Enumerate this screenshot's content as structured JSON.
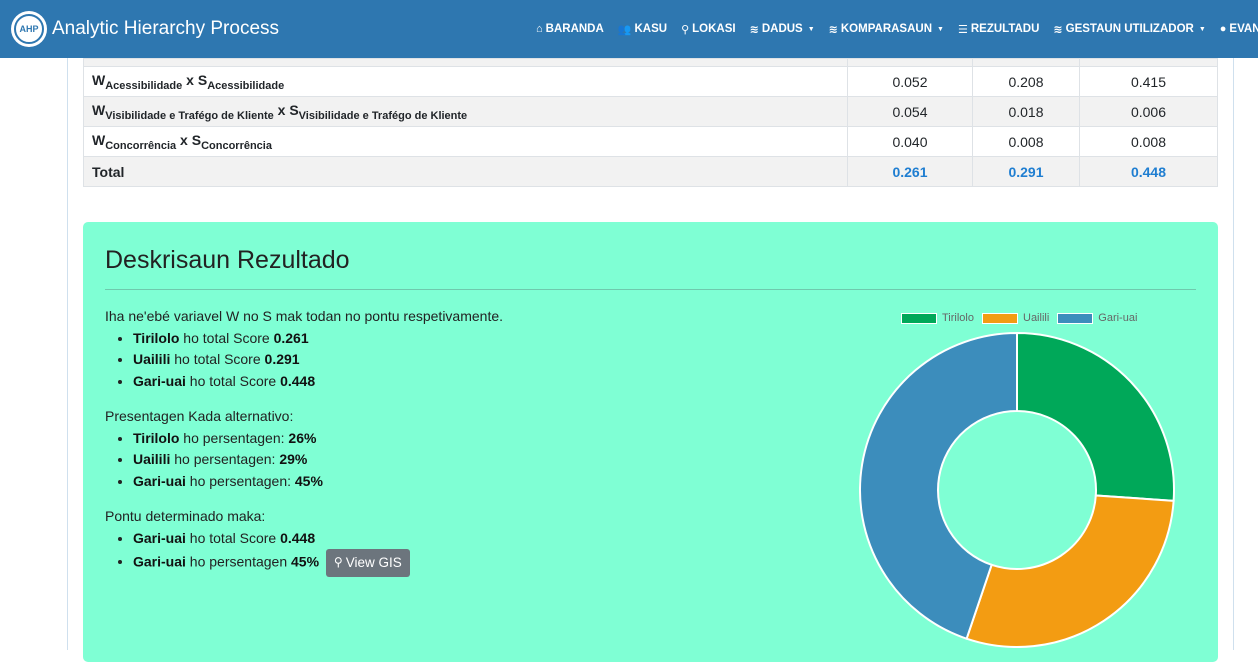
{
  "navbar": {
    "logo_text": "AHP",
    "title": "Analytic Hierarchy Process",
    "items": [
      {
        "icon": "home-icon",
        "glyph": "⌂",
        "label": "BARANDA",
        "dropdown": false
      },
      {
        "icon": "users-icon",
        "glyph": "👥",
        "label": "KASU",
        "dropdown": false
      },
      {
        "icon": "map-marker-icon",
        "glyph": "⚲",
        "label": "LOKASI",
        "dropdown": false
      },
      {
        "icon": "database-icon",
        "glyph": "≋",
        "label": "DADUS",
        "dropdown": true
      },
      {
        "icon": "database-icon",
        "glyph": "≋",
        "label": "KOMPARASAUN",
        "dropdown": true
      },
      {
        "icon": "list-icon",
        "glyph": "☰",
        "label": "REZULTADU",
        "dropdown": false
      },
      {
        "icon": "database-icon",
        "glyph": "≋",
        "label": "GESTAUN UTILIZADOR",
        "dropdown": true
      },
      {
        "icon": "user-icon",
        "glyph": "●",
        "label": "EVANGELINO",
        "dropdown": false
      }
    ]
  },
  "table": {
    "rows": [
      {
        "w": "W",
        "w_sub": "Acessibilidade",
        "x": "x",
        "s": "S",
        "s_sub": "Acessibilidade",
        "values": [
          "0.052",
          "0.208",
          "0.415"
        ]
      },
      {
        "w": "W",
        "w_sub": "Visibilidade e Trafégo de Kliente",
        "x": "x",
        "s": "S",
        "s_sub": "Visibilidade e Trafégo de Kliente",
        "values": [
          "0.054",
          "0.018",
          "0.006"
        ]
      },
      {
        "w": "W",
        "w_sub": "Concorrência",
        "x": "x",
        "s": "S",
        "s_sub": "Concorrência",
        "values": [
          "0.040",
          "0.008",
          "0.008"
        ]
      }
    ],
    "total_label": "Total",
    "totals": [
      "0.261",
      "0.291",
      "0.448"
    ]
  },
  "result": {
    "title": "Deskrisaun Rezultado",
    "intro": "Iha ne'ebé variavel W no S mak todan no pontu respetivamente.",
    "scores": [
      {
        "name": "Tirilolo",
        "text": " ho total Score ",
        "value": "0.261"
      },
      {
        "name": "Uailili",
        "text": " ho total Score ",
        "value": "0.291"
      },
      {
        "name": "Gari-uai",
        "text": " ho total Score ",
        "value": "0.448"
      }
    ],
    "percent_heading": "Presentagen Kada alternativo:",
    "percentages": [
      {
        "name": "Tirilolo",
        "text": " ho persentagen: ",
        "value": "26%"
      },
      {
        "name": "Uailili",
        "text": " ho persentagen: ",
        "value": "29%"
      },
      {
        "name": "Gari-uai",
        "text": " ho persentagen: ",
        "value": "45%"
      }
    ],
    "determined_heading": "Pontu determinado maka:",
    "determined": [
      {
        "name": "Gari-uai",
        "text": " ho total Score ",
        "value": "0.448"
      },
      {
        "name": "Gari-uai",
        "text": " ho persentagen ",
        "value": "45%"
      }
    ],
    "gis_button": "View GIS"
  },
  "chart_data": {
    "type": "pie",
    "variant": "doughnut",
    "legend_position": "top",
    "categories": [
      "Tirilolo",
      "Uailili",
      "Gari-uai"
    ],
    "values": [
      0.261,
      0.291,
      0.448
    ],
    "colors": [
      "#00a859",
      "#f39c12",
      "#3c8dbc"
    ]
  }
}
